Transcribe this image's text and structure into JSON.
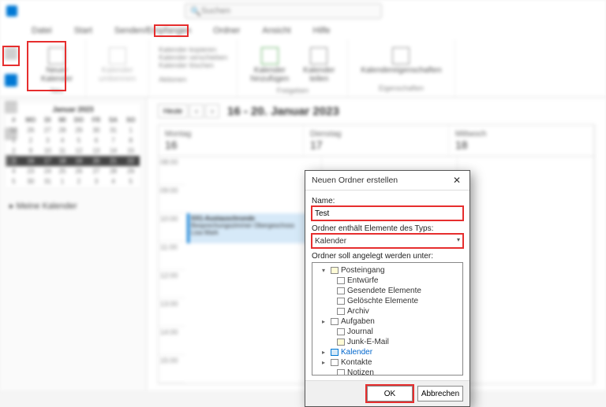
{
  "app": {
    "search_placeholder": "Suchen"
  },
  "menu": {
    "datei": "Datei",
    "start": "Start",
    "senden": "Senden/Empfangen",
    "ordner": "Ordner",
    "ansicht": "Ansicht",
    "hilfe": "Hilfe"
  },
  "ribbon": {
    "neuer_kalender": "Neuer\nKalender",
    "neu_label": "Neu",
    "kal_umb": "Kalender\numbennen",
    "act1": "Kalender kopieren",
    "act2": "Kalender verschieben",
    "act3": "Kalender löschen",
    "aktionen": "Aktionen",
    "hinzu": "Kalender\nhinzufügen",
    "teilen": "Kalender\nteilen",
    "freigeben": "Freigeben",
    "eigenschaften": "Kalendereigenschaften",
    "eig_label": "Eigenschaften"
  },
  "mini_cal": {
    "title": "Januar 2023",
    "dow": [
      "#",
      "MO",
      "DI",
      "MI",
      "DO",
      "FR",
      "SA",
      "SO"
    ],
    "rows": [
      [
        "52",
        "26",
        "27",
        "28",
        "29",
        "30",
        "31",
        "1"
      ],
      [
        "1",
        "2",
        "3",
        "4",
        "5",
        "6",
        "7",
        "8"
      ],
      [
        "2",
        "9",
        "10",
        "11",
        "12",
        "13",
        "14",
        "15"
      ],
      [
        "3",
        "16",
        "17",
        "18",
        "19",
        "20",
        "21",
        "22"
      ],
      [
        "4",
        "23",
        "24",
        "25",
        "26",
        "27",
        "28",
        "29"
      ],
      [
        "5",
        "30",
        "31",
        "1",
        "2",
        "3",
        "4",
        "5"
      ]
    ]
  },
  "left": {
    "mycal": "Meine Kalender"
  },
  "main": {
    "heute": "Heute",
    "range": "16 - 20. Januar 2023",
    "days": [
      {
        "name": "Montag",
        "num": "16"
      },
      {
        "name": "Dienstag",
        "num": "17"
      },
      {
        "name": "Mittwoch",
        "num": "18"
      }
    ],
    "times": [
      "08:00",
      "09:00",
      "10:00",
      "11:00",
      "12:00",
      "13:00",
      "14:00",
      "15:00"
    ],
    "evt_title": "XX1-Austauschrunde",
    "evt_sub": "Besprechungszimmer Obergeschoss\nLisa Mark"
  },
  "dialog": {
    "title": "Neuen Ordner erstellen",
    "name_label": "Name:",
    "name_value": "Test",
    "type_label": "Ordner enthält Elemente des Typs:",
    "type_value": "Kalender",
    "loc_label": "Ordner soll angelegt werden unter:",
    "tree": [
      {
        "lvl": 1,
        "tw": "▾",
        "ic": "mail",
        "label": "Posteingang"
      },
      {
        "lvl": 2,
        "tw": "",
        "ic": "plain",
        "label": "Entwürfe"
      },
      {
        "lvl": 2,
        "tw": "",
        "ic": "plain",
        "label": "Gesendete Elemente"
      },
      {
        "lvl": 2,
        "tw": "",
        "ic": "plain",
        "label": "Gelöschte Elemente"
      },
      {
        "lvl": 2,
        "tw": "",
        "ic": "plain",
        "label": "Archiv"
      },
      {
        "lvl": 1,
        "tw": "▸",
        "ic": "plain",
        "label": "Aufgaben"
      },
      {
        "lvl": 2,
        "tw": "",
        "ic": "plain",
        "label": "Journal"
      },
      {
        "lvl": 2,
        "tw": "",
        "ic": "mail",
        "label": "Junk-E-Mail"
      },
      {
        "lvl": 1,
        "tw": "▸",
        "ic": "cal",
        "label": "Kalender",
        "sel": true
      },
      {
        "lvl": 1,
        "tw": "▸",
        "ic": "plain",
        "label": "Kontakte"
      },
      {
        "lvl": 2,
        "tw": "",
        "ic": "plain",
        "label": "Notizen"
      }
    ],
    "ok": "OK",
    "cancel": "Abbrechen"
  }
}
